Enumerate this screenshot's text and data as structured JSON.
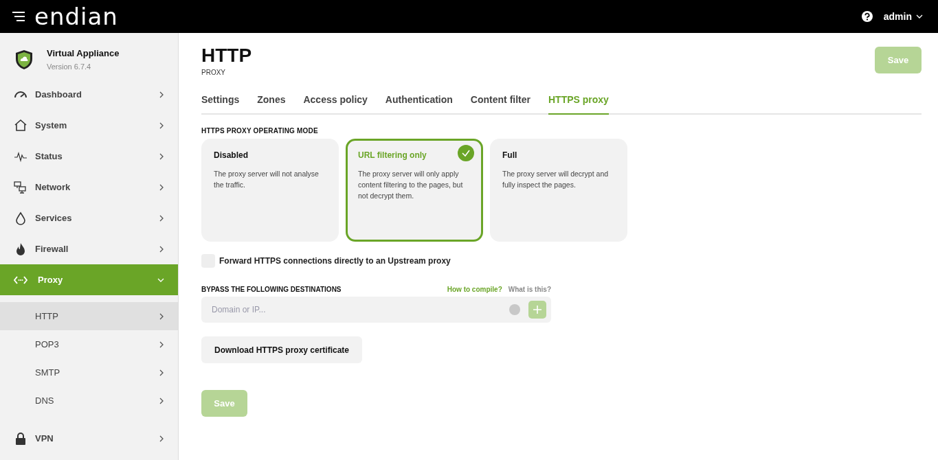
{
  "header": {
    "logo": "endian",
    "user": "admin"
  },
  "appliance": {
    "name": "Virtual Appliance",
    "version": "Version 6.7.4"
  },
  "sidebar": {
    "items": [
      {
        "label": "Dashboard",
        "selected": false,
        "expanded": false
      },
      {
        "label": "System",
        "selected": false,
        "expanded": false
      },
      {
        "label": "Status",
        "selected": false,
        "expanded": false
      },
      {
        "label": "Network",
        "selected": false,
        "expanded": false
      },
      {
        "label": "Services",
        "selected": false,
        "expanded": false
      },
      {
        "label": "Firewall",
        "selected": false,
        "expanded": false
      },
      {
        "label": "Proxy",
        "selected": true,
        "expanded": true,
        "children": [
          {
            "label": "HTTP",
            "selected": true
          },
          {
            "label": "POP3",
            "selected": false
          },
          {
            "label": "SMTP",
            "selected": false
          },
          {
            "label": "DNS",
            "selected": false
          }
        ]
      },
      {
        "label": "VPN",
        "selected": false,
        "expanded": false
      }
    ]
  },
  "page": {
    "title": "HTTP",
    "subtitle": "PROXY",
    "save": {
      "label": "Save",
      "disabled": true
    }
  },
  "tabs": [
    {
      "label": "Settings",
      "selected": false
    },
    {
      "label": "Zones",
      "selected": false
    },
    {
      "label": "Access policy",
      "selected": false
    },
    {
      "label": "Authentication",
      "selected": false
    },
    {
      "label": "Content filter",
      "selected": false
    },
    {
      "label": "HTTPS proxy",
      "selected": true
    }
  ],
  "mode": {
    "heading": "HTTPS PROXY OPERATING MODE",
    "options": [
      {
        "title": "Disabled",
        "description": "The proxy server will not analyse the traffic.",
        "selected": false
      },
      {
        "title": "URL filtering only",
        "description": "The proxy server will only apply content filtering to the pages, but not decrypt them.",
        "selected": true
      },
      {
        "title": "Full",
        "description": "The proxy server will decrypt and fully inspect the pages.",
        "selected": false
      }
    ]
  },
  "forward": {
    "label": "Forward HTTPS connections directly to an Upstream proxy",
    "checked": false
  },
  "bypass": {
    "heading": "BYPASS THE FOLLOWING DESTINATIONS",
    "help_link": "How to compile?",
    "info_link": "What is this?",
    "placeholder": "Domain or IP..."
  },
  "download": {
    "label": "Download HTTPS proxy certificate"
  },
  "footer_save": {
    "label": "Save",
    "disabled": true
  }
}
